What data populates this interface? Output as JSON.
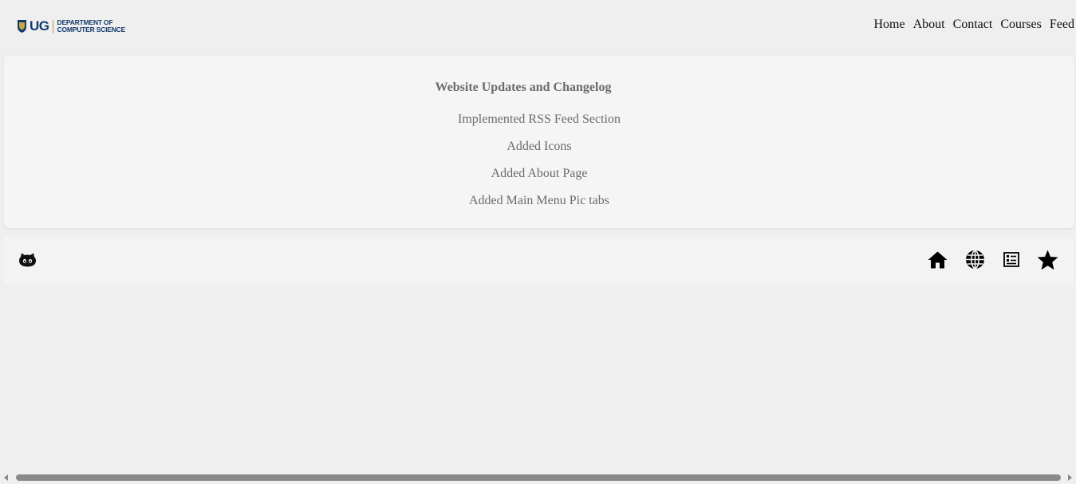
{
  "header": {
    "logo": {
      "abbr": "UG",
      "line1": "DEPARTMENT OF",
      "line2": "COMPUTER SCIENCE"
    },
    "nav": [
      {
        "label": "Home"
      },
      {
        "label": "About"
      },
      {
        "label": "Contact"
      },
      {
        "label": "Courses"
      },
      {
        "label": "Feed"
      }
    ]
  },
  "changelog": {
    "title": "Website Updates and Changelog",
    "items": [
      "Implemented RSS Feed Section",
      "Added Icons",
      "Added About Page",
      "Added Main Menu Pic tabs"
    ]
  },
  "footer": {
    "left_icons": [
      "github-icon"
    ],
    "right_icons": [
      "home-icon",
      "globe-icon",
      "news-icon",
      "star-icon"
    ]
  },
  "colors": {
    "page_bg": "#efefef",
    "card_bg": "#f5f5f5",
    "footer_bg": "#f3f3f3",
    "text_muted": "#6b6b6b",
    "brand_blue": "#123a6e"
  }
}
